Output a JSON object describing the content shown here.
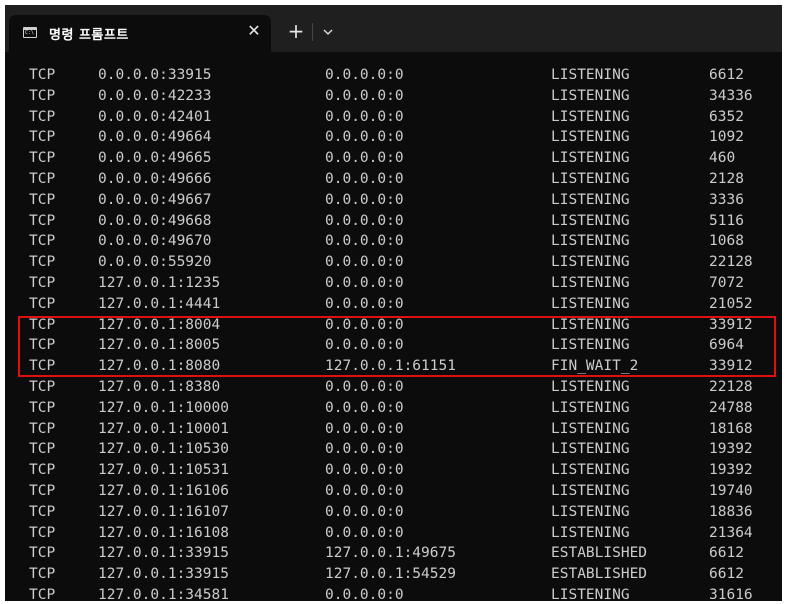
{
  "tab": {
    "icon_text": "C:\\",
    "title": "명령 프롬프트",
    "close_glyph": "✕",
    "new_tab_glyph": "+",
    "dropdown_glyph": "chevron-down-icon"
  },
  "colors": {
    "tabbar": "#1f1f1f",
    "terminal_bg": "#0c0c0c",
    "text": "#cccccc",
    "highlight": "#e01010"
  },
  "connections": [
    {
      "proto": "TCP",
      "local": "0.0.0.0:33915",
      "foreign": "0.0.0.0:0",
      "state": "LISTENING",
      "pid": "6612"
    },
    {
      "proto": "TCP",
      "local": "0.0.0.0:42233",
      "foreign": "0.0.0.0:0",
      "state": "LISTENING",
      "pid": "34336"
    },
    {
      "proto": "TCP",
      "local": "0.0.0.0:42401",
      "foreign": "0.0.0.0:0",
      "state": "LISTENING",
      "pid": "6352"
    },
    {
      "proto": "TCP",
      "local": "0.0.0.0:49664",
      "foreign": "0.0.0.0:0",
      "state": "LISTENING",
      "pid": "1092"
    },
    {
      "proto": "TCP",
      "local": "0.0.0.0:49665",
      "foreign": "0.0.0.0:0",
      "state": "LISTENING",
      "pid": "460"
    },
    {
      "proto": "TCP",
      "local": "0.0.0.0:49666",
      "foreign": "0.0.0.0:0",
      "state": "LISTENING",
      "pid": "2128"
    },
    {
      "proto": "TCP",
      "local": "0.0.0.0:49667",
      "foreign": "0.0.0.0:0",
      "state": "LISTENING",
      "pid": "3336"
    },
    {
      "proto": "TCP",
      "local": "0.0.0.0:49668",
      "foreign": "0.0.0.0:0",
      "state": "LISTENING",
      "pid": "5116"
    },
    {
      "proto": "TCP",
      "local": "0.0.0.0:49670",
      "foreign": "0.0.0.0:0",
      "state": "LISTENING",
      "pid": "1068"
    },
    {
      "proto": "TCP",
      "local": "0.0.0.0:55920",
      "foreign": "0.0.0.0:0",
      "state": "LISTENING",
      "pid": "22128"
    },
    {
      "proto": "TCP",
      "local": "127.0.0.1:1235",
      "foreign": "0.0.0.0:0",
      "state": "LISTENING",
      "pid": "7072"
    },
    {
      "proto": "TCP",
      "local": "127.0.0.1:4441",
      "foreign": "0.0.0.0:0",
      "state": "LISTENING",
      "pid": "21052"
    },
    {
      "proto": "TCP",
      "local": "127.0.0.1:8004",
      "foreign": "0.0.0.0:0",
      "state": "LISTENING",
      "pid": "33912"
    },
    {
      "proto": "TCP",
      "local": "127.0.0.1:8005",
      "foreign": "0.0.0.0:0",
      "state": "LISTENING",
      "pid": "6964"
    },
    {
      "proto": "TCP",
      "local": "127.0.0.1:8080",
      "foreign": "127.0.0.1:61151",
      "state": "FIN_WAIT_2",
      "pid": "33912"
    },
    {
      "proto": "TCP",
      "local": "127.0.0.1:8380",
      "foreign": "0.0.0.0:0",
      "state": "LISTENING",
      "pid": "22128"
    },
    {
      "proto": "TCP",
      "local": "127.0.0.1:10000",
      "foreign": "0.0.0.0:0",
      "state": "LISTENING",
      "pid": "24788"
    },
    {
      "proto": "TCP",
      "local": "127.0.0.1:10001",
      "foreign": "0.0.0.0:0",
      "state": "LISTENING",
      "pid": "18168"
    },
    {
      "proto": "TCP",
      "local": "127.0.0.1:10530",
      "foreign": "0.0.0.0:0",
      "state": "LISTENING",
      "pid": "19392"
    },
    {
      "proto": "TCP",
      "local": "127.0.0.1:10531",
      "foreign": "0.0.0.0:0",
      "state": "LISTENING",
      "pid": "19392"
    },
    {
      "proto": "TCP",
      "local": "127.0.0.1:16106",
      "foreign": "0.0.0.0:0",
      "state": "LISTENING",
      "pid": "19740"
    },
    {
      "proto": "TCP",
      "local": "127.0.0.1:16107",
      "foreign": "0.0.0.0:0",
      "state": "LISTENING",
      "pid": "18836"
    },
    {
      "proto": "TCP",
      "local": "127.0.0.1:16108",
      "foreign": "0.0.0.0:0",
      "state": "LISTENING",
      "pid": "21364"
    },
    {
      "proto": "TCP",
      "local": "127.0.0.1:33915",
      "foreign": "127.0.0.1:49675",
      "state": "ESTABLISHED",
      "pid": "6612"
    },
    {
      "proto": "TCP",
      "local": "127.0.0.1:33915",
      "foreign": "127.0.0.1:54529",
      "state": "ESTABLISHED",
      "pid": "6612"
    },
    {
      "proto": "TCP",
      "local": "127.0.0.1:34581",
      "foreign": "0.0.0.0:0",
      "state": "LISTENING",
      "pid": "31616"
    }
  ]
}
